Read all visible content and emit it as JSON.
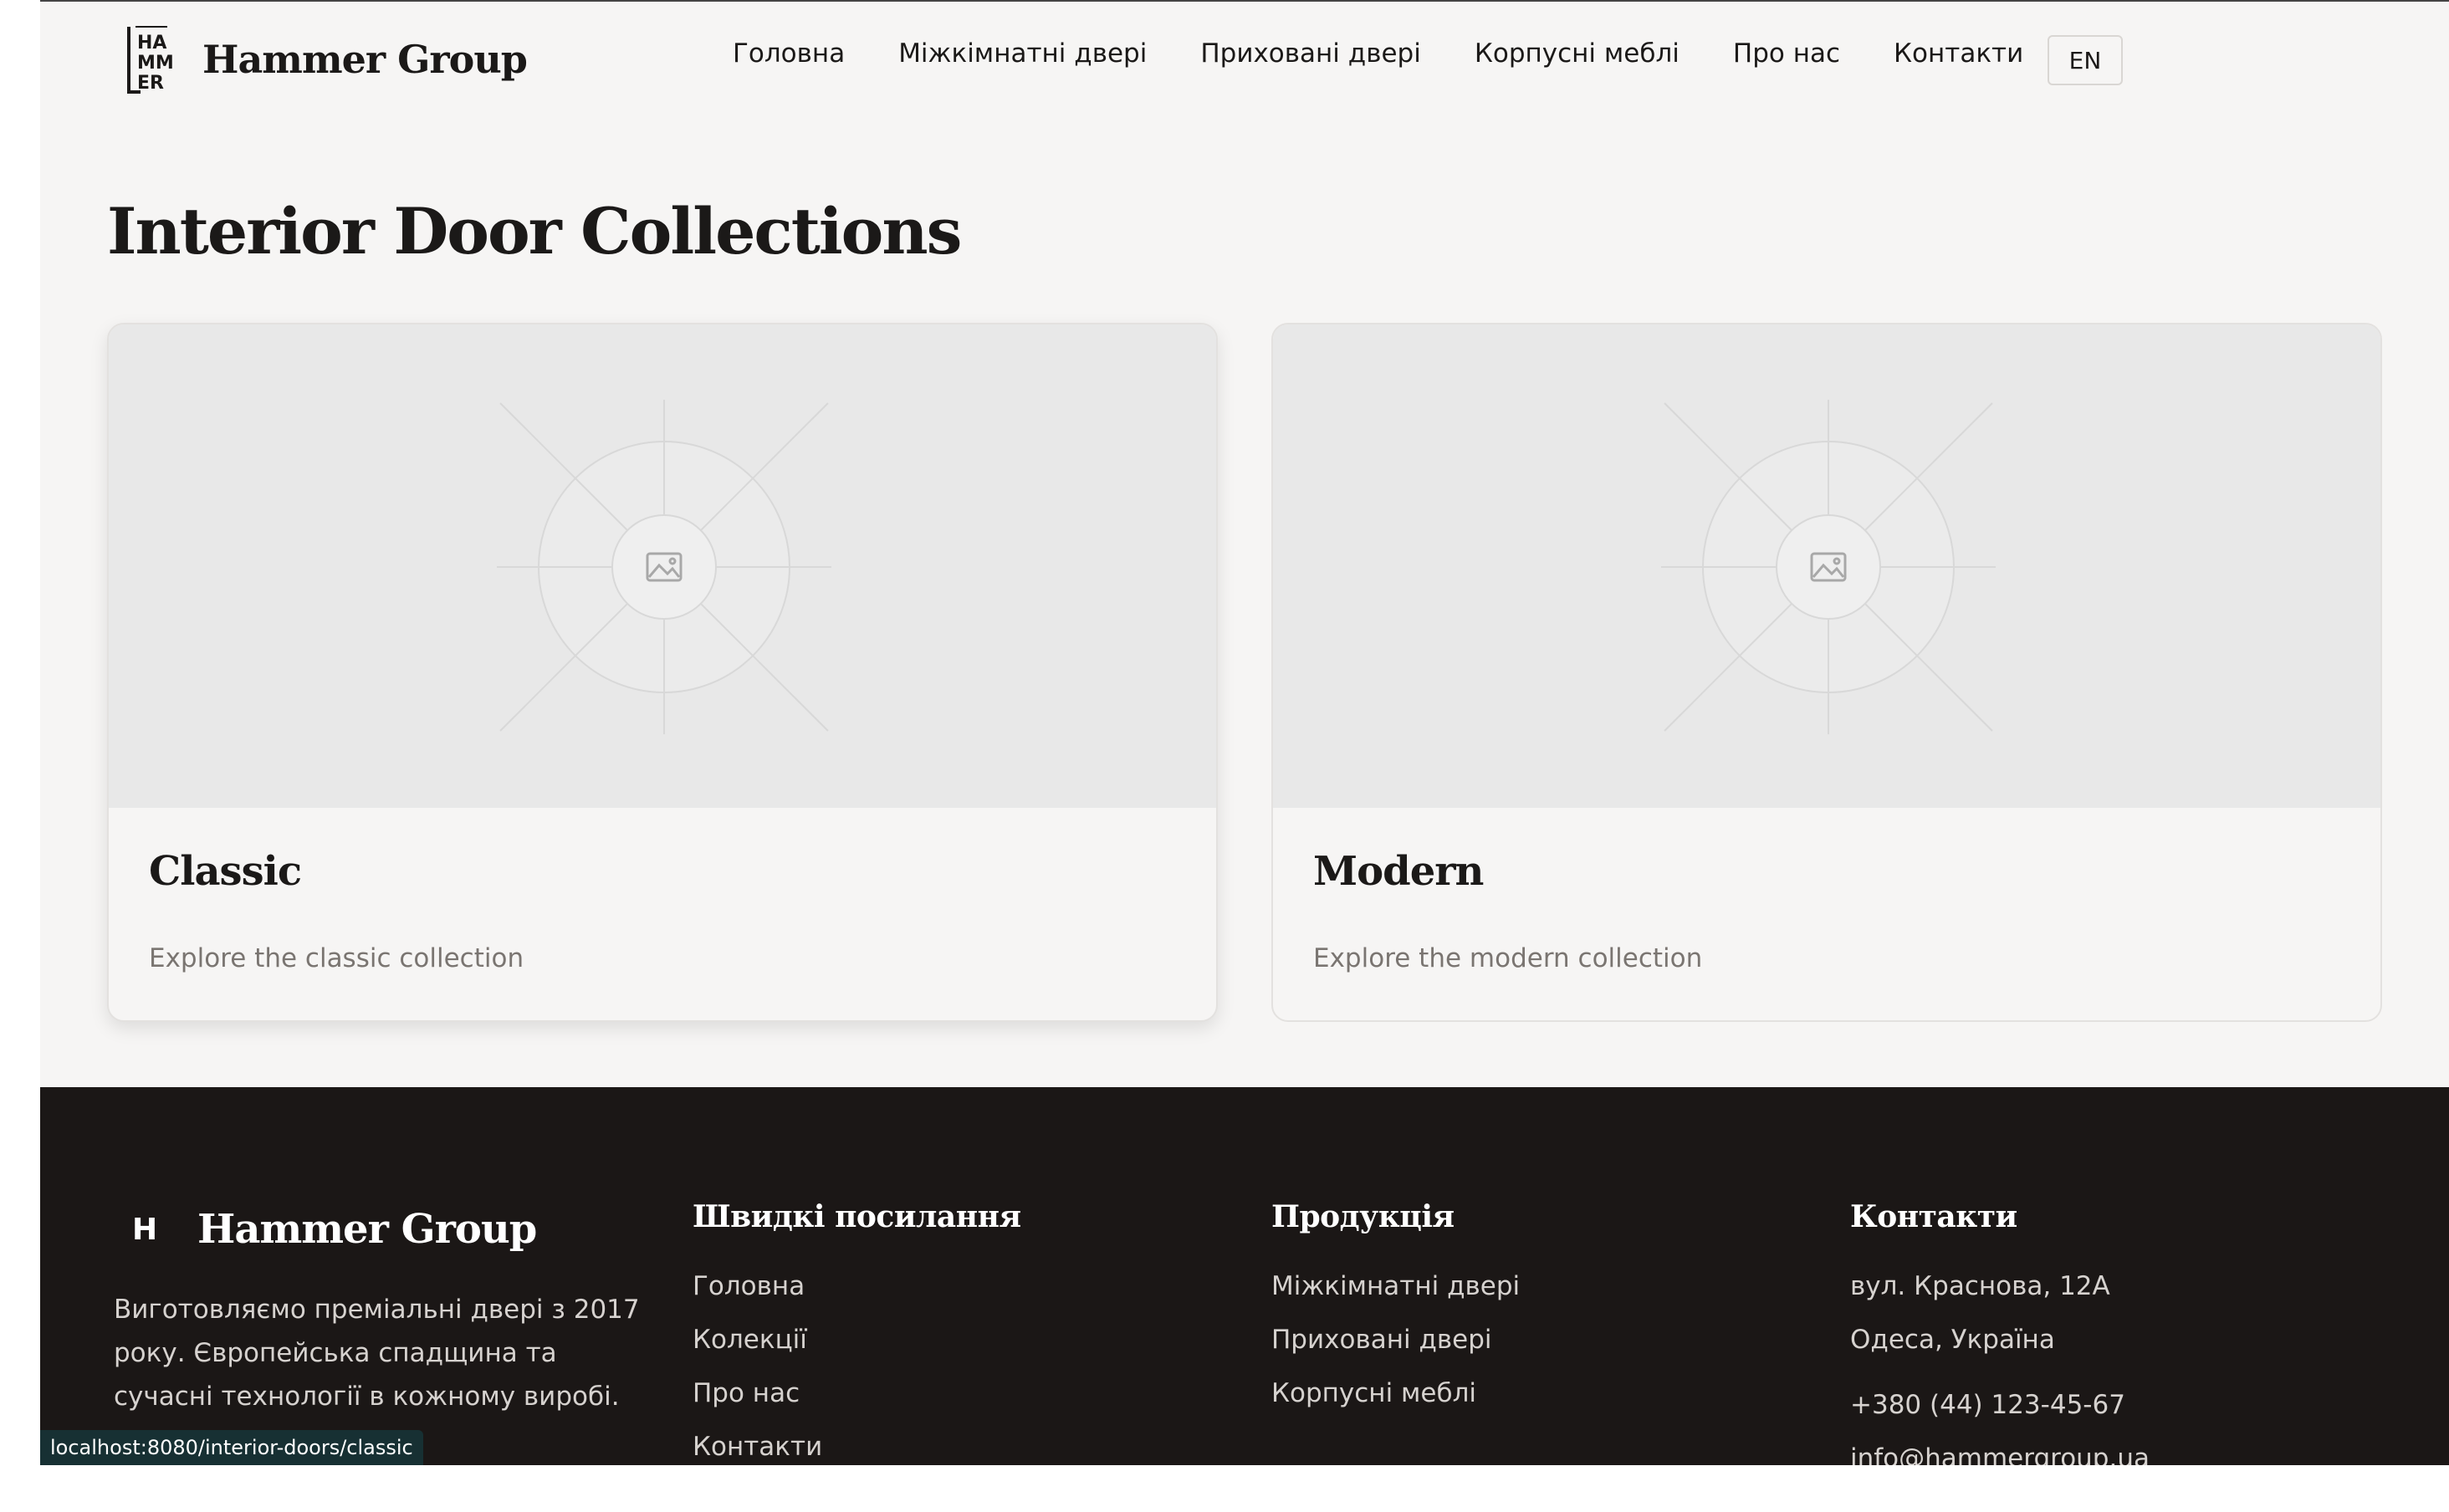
{
  "brand": {
    "logo_letters": [
      "HA",
      "MM",
      "ER"
    ],
    "name": "Hammer Group"
  },
  "nav": {
    "items": [
      {
        "label": "Головна"
      },
      {
        "label": "Міжкімнатні двері"
      },
      {
        "label": "Приховані двері"
      },
      {
        "label": "Корпусні меблі"
      },
      {
        "label": "Про нас"
      },
      {
        "label": "Контакти"
      }
    ],
    "lang": "EN"
  },
  "page": {
    "title": "Interior Door Collections"
  },
  "cards": [
    {
      "title": "Classic",
      "description": "Explore the classic collection",
      "image_icon": "image-placeholder-icon"
    },
    {
      "title": "Modern",
      "description": "Explore the modern collection",
      "image_icon": "image-placeholder-icon"
    }
  ],
  "footer": {
    "logo_letter": "H",
    "brand_name": "Hammer Group",
    "about": "Виготовляємо преміальні двері з 2017 року. Європейська спадщина та сучасні технології в кожному виробі.",
    "quick_links": {
      "heading": "Швидкі посилання",
      "items": [
        "Головна",
        "Колекції",
        "Про нас",
        "Контакти"
      ]
    },
    "products": {
      "heading": "Продукція",
      "items": [
        "Міжкімнатні двері",
        "Приховані двері",
        "Корпусні меблі"
      ]
    },
    "contacts": {
      "heading": "Контакти",
      "address_line1": "вул. Краснова, 12А",
      "address_line2": "Одеса, Україна",
      "phone": "+380 (44) 123-45-67",
      "email": "info@hammergroup.ua"
    }
  },
  "status_bar": {
    "url": "localhost:8080/interior-doors/classic"
  },
  "colors": {
    "background": "#f6f5f4",
    "text": "#1b1918",
    "muted": "#7a7571",
    "footer_bg": "#1b1716",
    "footer_text": "#d6d2cf",
    "placeholder": "#e8e8e8"
  }
}
